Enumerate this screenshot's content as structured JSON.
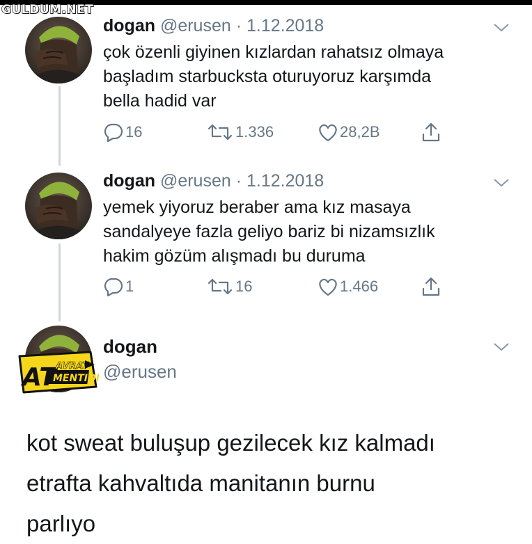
{
  "watermark": "GULDUM.NET",
  "colors": {
    "text": "#14171a",
    "muted": "#657786",
    "thread_line": "#ccd6dd",
    "badge_yellow": "#f5d61a"
  },
  "icons": {
    "reply": "reply-icon",
    "retweet": "retweet-icon",
    "like": "heart-icon",
    "share": "share-icon",
    "more": "chevron-down-icon"
  },
  "tweets": [
    {
      "name": "dogan",
      "handle": "@erusen · 1.12.2018",
      "text": "çok özenli giyinen kızlardan rahatsız olmaya\nbaşladım starbucksta oturuyoruz karşımda\nbella hadid var",
      "replies": "16",
      "retweets": "1.336",
      "likes": "28,2B"
    },
    {
      "name": "dogan",
      "handle": "@erusen · 1.12.2018",
      "text": "yemek yiyoruz beraber ama kız masaya\nsandalyeye fazla geliyo bariz bi nizamsızlık\nhakim gözüm alışmadı bu duruma",
      "replies": "1",
      "retweets": "16",
      "likes": "1.466"
    }
  ],
  "main_tweet": {
    "name": "dogan",
    "handle": "@erusen",
    "text": "kot sweat buluşup gezilecek kız kalmadı\netrafta kahvaltıda manitanın burnu\nparlıyo"
  },
  "badge": {
    "big": "AT",
    "line1": "AVRAT",
    "line2": "MENTION"
  }
}
